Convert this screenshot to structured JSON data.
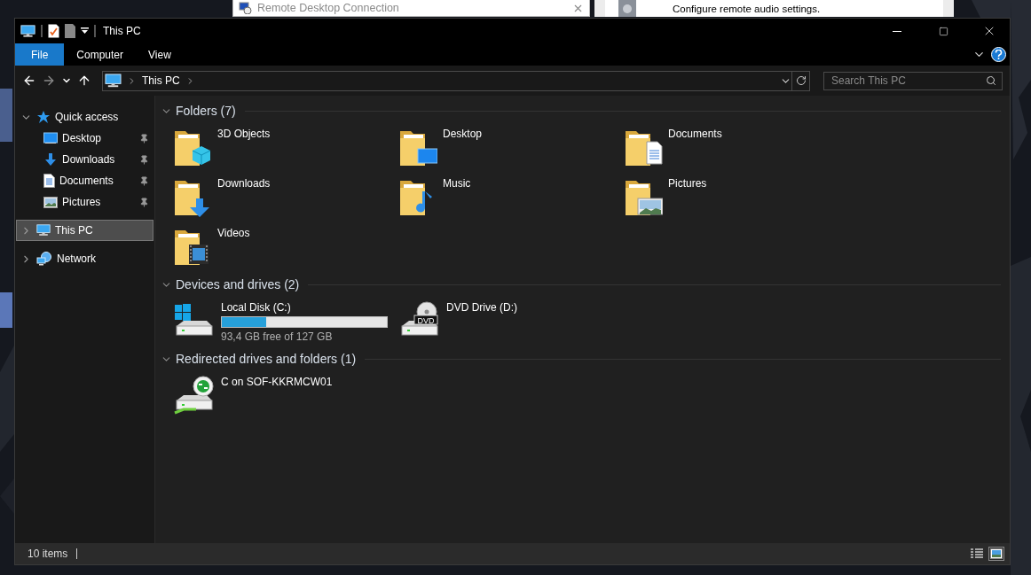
{
  "background_windows": [
    {
      "kind": "titlebar",
      "text": "Remote Desktop Connection"
    },
    {
      "kind": "panel",
      "text": "Configure remote audio settings."
    }
  ],
  "window": {
    "title": "This PC"
  },
  "ribbon": {
    "tabs": [
      {
        "label": "File",
        "selected": true
      },
      {
        "label": "Computer",
        "selected": false
      },
      {
        "label": "View",
        "selected": false
      }
    ]
  },
  "address_bar": {
    "path": [
      "This PC"
    ]
  },
  "search": {
    "placeholder": "Search This PC"
  },
  "sidebar": {
    "items": [
      {
        "label": "Quick access",
        "kind": "star",
        "expanded": true,
        "selected": false,
        "children": [
          {
            "label": "Desktop",
            "kind": "desktop",
            "pinned": true,
            "selected": false
          },
          {
            "label": "Downloads",
            "kind": "downloads",
            "pinned": true,
            "selected": false
          },
          {
            "label": "Documents",
            "kind": "documents",
            "pinned": true,
            "selected": false
          },
          {
            "label": "Pictures",
            "kind": "pictures",
            "pinned": true,
            "selected": false
          }
        ]
      },
      {
        "label": "This PC",
        "kind": "pc",
        "expanded": false,
        "selected": true
      },
      {
        "label": "Network",
        "kind": "network",
        "expanded": false,
        "selected": false
      }
    ]
  },
  "groups": [
    {
      "title": "Folders (7)",
      "expanded": true,
      "items": [
        {
          "kind": "objects",
          "name": "3D Objects"
        },
        {
          "kind": "desktop",
          "name": "Desktop"
        },
        {
          "kind": "documents",
          "name": "Documents"
        },
        {
          "kind": "downloads",
          "name": "Downloads"
        },
        {
          "kind": "music",
          "name": "Music"
        },
        {
          "kind": "pictures",
          "name": "Pictures"
        },
        {
          "kind": "videos",
          "name": "Videos"
        }
      ]
    },
    {
      "title": "Devices and drives (2)",
      "expanded": true,
      "items": [
        {
          "kind": "windows",
          "name": "Local Disk (C:)",
          "level": 0.27,
          "detail": "93,4 GB free of 127 GB"
        },
        {
          "kind": "dvd",
          "name": "DVD Drive (D:)",
          "icon_text": "DVD"
        }
      ]
    },
    {
      "title": "Redirected drives and folders (1)",
      "expanded": true,
      "items": [
        {
          "kind": "redirect",
          "name": "C on SOF-KKRMCW01"
        }
      ]
    }
  ],
  "status_bar": {
    "count": "10 items",
    "views": [
      {
        "kind": "details",
        "selected": false
      },
      {
        "kind": "tiles",
        "selected": true
      }
    ]
  }
}
